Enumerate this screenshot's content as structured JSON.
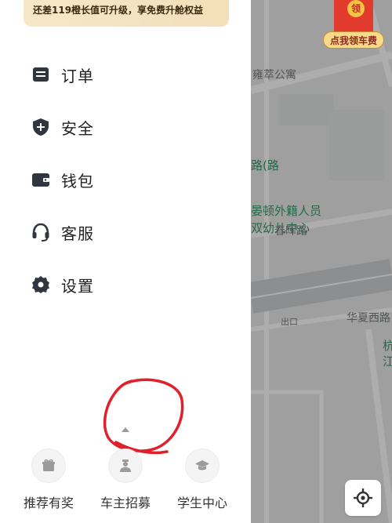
{
  "banner": {
    "text": "还差119橙长值可升级，享免费升舱权益"
  },
  "menu": [
    {
      "label": "订单",
      "icon": "order-icon"
    },
    {
      "label": "安全",
      "icon": "shield-icon"
    },
    {
      "label": "钱包",
      "icon": "wallet-icon"
    },
    {
      "label": "客服",
      "icon": "headset-icon"
    },
    {
      "label": "设置",
      "icon": "gear-icon"
    }
  ],
  "bottom": [
    {
      "label": "推荐有奖",
      "icon": "gift-icon"
    },
    {
      "label": "车主招募",
      "icon": "driver-icon"
    },
    {
      "label": "学生中心",
      "icon": "graduation-cap-icon"
    }
  ],
  "map": {
    "labels": [
      "雍萃公寓",
      "路(路",
      "晏顿外籍人员",
      "双幼儿中心",
      "春晖路",
      "出口",
      "华夏西路",
      "杭",
      "江"
    ],
    "promo": {
      "coin": "领",
      "tag": "点我领车费"
    }
  },
  "colors": {
    "accent_red": "#e23b2e",
    "banner_gold": "#f6e7c9",
    "icon_dark": "#2f3640"
  }
}
